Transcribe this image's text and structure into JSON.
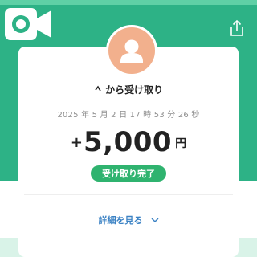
{
  "header": {
    "record_icon": "video-camera-icon",
    "share_icon": "share-icon"
  },
  "transaction": {
    "avatar_icon": "user-silhouette-icon",
    "title": "から受け取り",
    "title_prefix_icon": "sender-name-fragment",
    "timestamp": "2025 年 5 月 2 日  17 時 53 分 26 秒",
    "amount_sign": "+",
    "amount_value": "5,000",
    "amount_unit": "円",
    "status": "受け取り完了",
    "details_link": "詳細を見る",
    "details_icon": "chevron-down-icon"
  },
  "colors": {
    "brand_green": "#2db286",
    "light_green": "#d9f3e8",
    "status_green": "#2fb36f",
    "avatar": "#f2b08d",
    "link_blue": "#3b82c4"
  }
}
